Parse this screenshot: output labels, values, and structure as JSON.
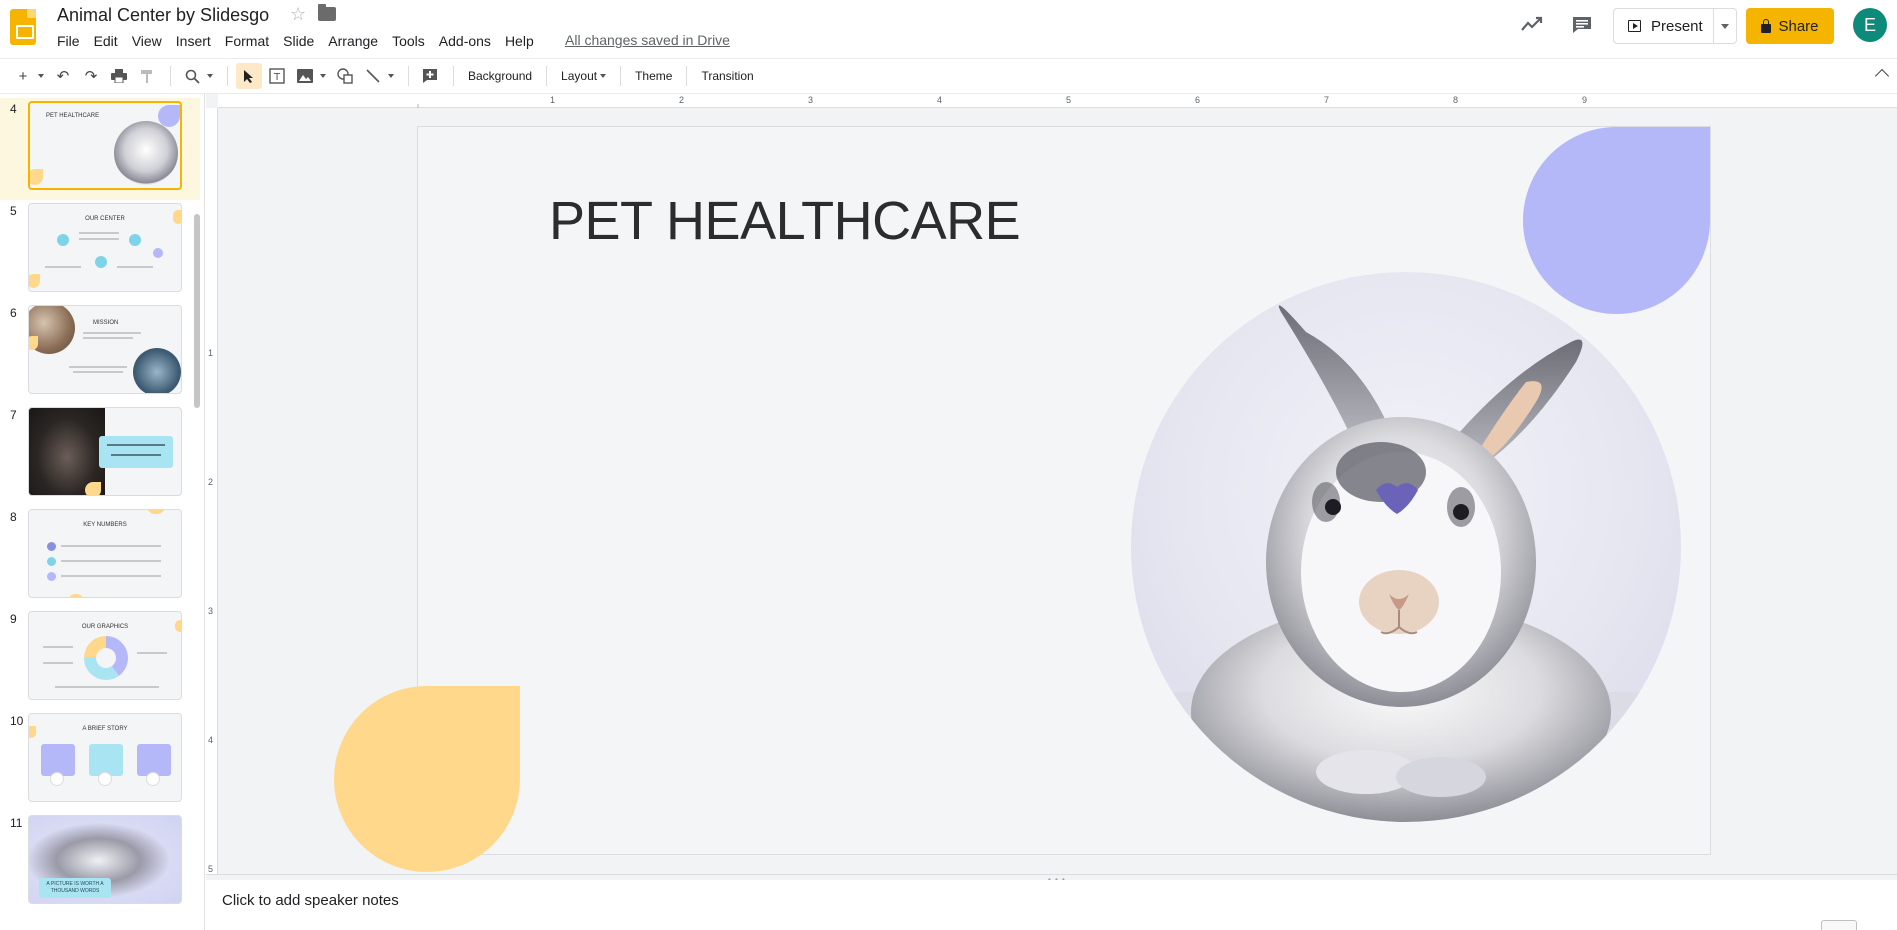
{
  "header": {
    "doc_title": "Animal Center by Slidesgo",
    "menu": [
      "File",
      "Edit",
      "View",
      "Insert",
      "Format",
      "Slide",
      "Arrange",
      "Tools",
      "Add-ons",
      "Help"
    ],
    "save_status": "All changes saved in Drive",
    "present_label": "Present",
    "share_label": "Share",
    "avatar_letter": "E"
  },
  "toolbar": {
    "background_label": "Background",
    "layout_label": "Layout",
    "theme_label": "Theme",
    "transition_label": "Transition"
  },
  "filmstrip": {
    "slides": [
      {
        "num": "4",
        "title": "PET HEALTHCARE"
      },
      {
        "num": "5",
        "title": "OUR CENTER"
      },
      {
        "num": "6",
        "title": "MISSION"
      },
      {
        "num": "7",
        "title": ""
      },
      {
        "num": "8",
        "title": "KEY NUMBERS"
      },
      {
        "num": "9",
        "title": "OUR GRAPHICS"
      },
      {
        "num": "10",
        "title": "A BRIEF STORY"
      },
      {
        "num": "11",
        "title": "A PICTURE IS WORTH A THOUSAND WORDS"
      }
    ]
  },
  "ruler": {
    "h_marks": [
      "1",
      "2",
      "3",
      "4",
      "5",
      "6",
      "7",
      "8",
      "9"
    ],
    "v_marks": [
      "1",
      "2",
      "3",
      "4",
      "5"
    ]
  },
  "slide": {
    "title": "PET HEALTHCARE"
  },
  "notes": {
    "placeholder": "Click to add speaker notes"
  },
  "colors": {
    "accent_yellow": "#F4B400",
    "deco_purple": "#B4B8F8",
    "deco_yellow": "#FFD88C",
    "avatar": "#0e8a7a"
  }
}
